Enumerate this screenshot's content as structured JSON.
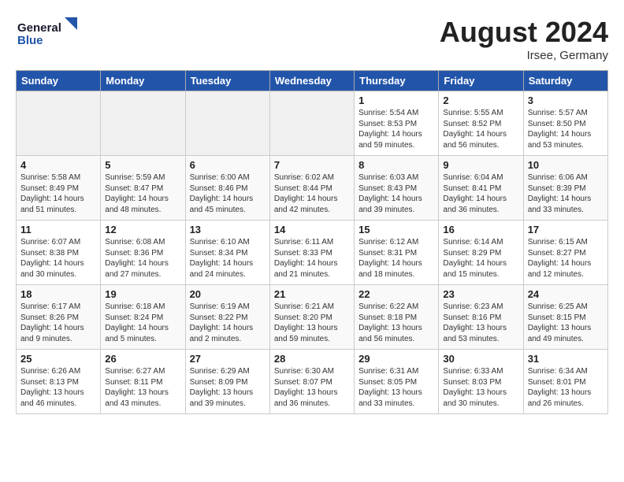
{
  "header": {
    "logo_line1": "General",
    "logo_line2": "Blue",
    "month_year": "August 2024",
    "location": "Irsee, Germany"
  },
  "weekdays": [
    "Sunday",
    "Monday",
    "Tuesday",
    "Wednesday",
    "Thursday",
    "Friday",
    "Saturday"
  ],
  "weeks": [
    [
      {
        "day": "",
        "info": ""
      },
      {
        "day": "",
        "info": ""
      },
      {
        "day": "",
        "info": ""
      },
      {
        "day": "",
        "info": ""
      },
      {
        "day": "1",
        "info": "Sunrise: 5:54 AM\nSunset: 8:53 PM\nDaylight: 14 hours\nand 59 minutes."
      },
      {
        "day": "2",
        "info": "Sunrise: 5:55 AM\nSunset: 8:52 PM\nDaylight: 14 hours\nand 56 minutes."
      },
      {
        "day": "3",
        "info": "Sunrise: 5:57 AM\nSunset: 8:50 PM\nDaylight: 14 hours\nand 53 minutes."
      }
    ],
    [
      {
        "day": "4",
        "info": "Sunrise: 5:58 AM\nSunset: 8:49 PM\nDaylight: 14 hours\nand 51 minutes."
      },
      {
        "day": "5",
        "info": "Sunrise: 5:59 AM\nSunset: 8:47 PM\nDaylight: 14 hours\nand 48 minutes."
      },
      {
        "day": "6",
        "info": "Sunrise: 6:00 AM\nSunset: 8:46 PM\nDaylight: 14 hours\nand 45 minutes."
      },
      {
        "day": "7",
        "info": "Sunrise: 6:02 AM\nSunset: 8:44 PM\nDaylight: 14 hours\nand 42 minutes."
      },
      {
        "day": "8",
        "info": "Sunrise: 6:03 AM\nSunset: 8:43 PM\nDaylight: 14 hours\nand 39 minutes."
      },
      {
        "day": "9",
        "info": "Sunrise: 6:04 AM\nSunset: 8:41 PM\nDaylight: 14 hours\nand 36 minutes."
      },
      {
        "day": "10",
        "info": "Sunrise: 6:06 AM\nSunset: 8:39 PM\nDaylight: 14 hours\nand 33 minutes."
      }
    ],
    [
      {
        "day": "11",
        "info": "Sunrise: 6:07 AM\nSunset: 8:38 PM\nDaylight: 14 hours\nand 30 minutes."
      },
      {
        "day": "12",
        "info": "Sunrise: 6:08 AM\nSunset: 8:36 PM\nDaylight: 14 hours\nand 27 minutes."
      },
      {
        "day": "13",
        "info": "Sunrise: 6:10 AM\nSunset: 8:34 PM\nDaylight: 14 hours\nand 24 minutes."
      },
      {
        "day": "14",
        "info": "Sunrise: 6:11 AM\nSunset: 8:33 PM\nDaylight: 14 hours\nand 21 minutes."
      },
      {
        "day": "15",
        "info": "Sunrise: 6:12 AM\nSunset: 8:31 PM\nDaylight: 14 hours\nand 18 minutes."
      },
      {
        "day": "16",
        "info": "Sunrise: 6:14 AM\nSunset: 8:29 PM\nDaylight: 14 hours\nand 15 minutes."
      },
      {
        "day": "17",
        "info": "Sunrise: 6:15 AM\nSunset: 8:27 PM\nDaylight: 14 hours\nand 12 minutes."
      }
    ],
    [
      {
        "day": "18",
        "info": "Sunrise: 6:17 AM\nSunset: 8:26 PM\nDaylight: 14 hours\nand 9 minutes."
      },
      {
        "day": "19",
        "info": "Sunrise: 6:18 AM\nSunset: 8:24 PM\nDaylight: 14 hours\nand 5 minutes."
      },
      {
        "day": "20",
        "info": "Sunrise: 6:19 AM\nSunset: 8:22 PM\nDaylight: 14 hours\nand 2 minutes."
      },
      {
        "day": "21",
        "info": "Sunrise: 6:21 AM\nSunset: 8:20 PM\nDaylight: 13 hours\nand 59 minutes."
      },
      {
        "day": "22",
        "info": "Sunrise: 6:22 AM\nSunset: 8:18 PM\nDaylight: 13 hours\nand 56 minutes."
      },
      {
        "day": "23",
        "info": "Sunrise: 6:23 AM\nSunset: 8:16 PM\nDaylight: 13 hours\nand 53 minutes."
      },
      {
        "day": "24",
        "info": "Sunrise: 6:25 AM\nSunset: 8:15 PM\nDaylight: 13 hours\nand 49 minutes."
      }
    ],
    [
      {
        "day": "25",
        "info": "Sunrise: 6:26 AM\nSunset: 8:13 PM\nDaylight: 13 hours\nand 46 minutes."
      },
      {
        "day": "26",
        "info": "Sunrise: 6:27 AM\nSunset: 8:11 PM\nDaylight: 13 hours\nand 43 minutes."
      },
      {
        "day": "27",
        "info": "Sunrise: 6:29 AM\nSunset: 8:09 PM\nDaylight: 13 hours\nand 39 minutes."
      },
      {
        "day": "28",
        "info": "Sunrise: 6:30 AM\nSunset: 8:07 PM\nDaylight: 13 hours\nand 36 minutes."
      },
      {
        "day": "29",
        "info": "Sunrise: 6:31 AM\nSunset: 8:05 PM\nDaylight: 13 hours\nand 33 minutes."
      },
      {
        "day": "30",
        "info": "Sunrise: 6:33 AM\nSunset: 8:03 PM\nDaylight: 13 hours\nand 30 minutes."
      },
      {
        "day": "31",
        "info": "Sunrise: 6:34 AM\nSunset: 8:01 PM\nDaylight: 13 hours\nand 26 minutes."
      }
    ]
  ]
}
